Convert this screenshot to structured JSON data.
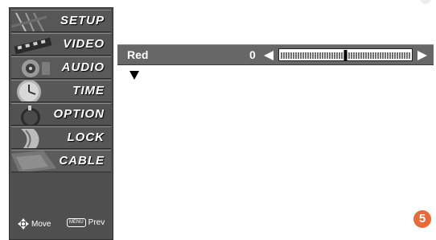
{
  "menu": {
    "items": [
      {
        "label": "SETUP",
        "icon": "setup-thumbnail-icon"
      },
      {
        "label": "VIDEO",
        "icon": "video-thumbnail-icon"
      },
      {
        "label": "AUDIO",
        "icon": "audio-thumbnail-icon"
      },
      {
        "label": "TIME",
        "icon": "time-thumbnail-icon"
      },
      {
        "label": "OPTION",
        "icon": "option-thumbnail-icon"
      },
      {
        "label": "LOCK",
        "icon": "lock-thumbnail-icon"
      },
      {
        "label": "CABLE",
        "icon": "cable-thumbnail-icon"
      }
    ],
    "footer": {
      "move_label": "Move",
      "menu_key_label": "MENU",
      "prev_label": "Prev"
    }
  },
  "adjustment": {
    "label": "Red",
    "value": "0",
    "level": 0.5
  },
  "step_badge": "5",
  "colors": {
    "panel_bg": "#4f4f4f",
    "bar_bg": "#676767",
    "badge": "#e86a3a"
  }
}
